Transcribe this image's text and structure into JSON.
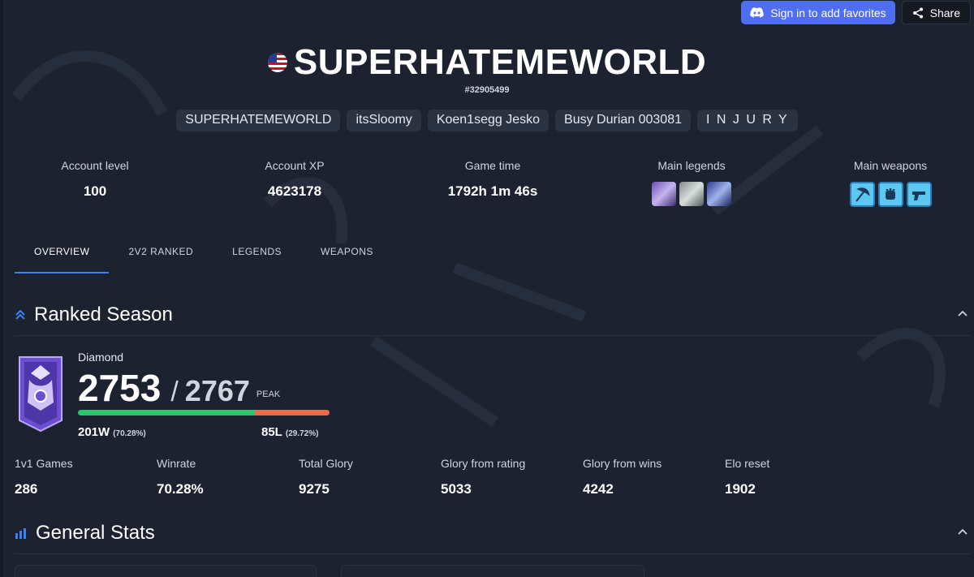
{
  "top": {
    "discord_label": "Sign in to add favorites",
    "share_label": "Share"
  },
  "player": {
    "name": "SUPERHATEMEWORLD",
    "id": "#32905499",
    "flag": "us-flag-icon"
  },
  "aliases": [
    "SUPERHATEMEWORLD",
    "itsSloomy",
    "Koen1segg Jesko",
    "Busy Durian 003081",
    "I N J U R Y"
  ],
  "stats": {
    "account_level": {
      "label": "Account level",
      "value": "100"
    },
    "account_xp": {
      "label": "Account XP",
      "value": "4623178"
    },
    "game_time": {
      "label": "Game time",
      "value": "1792h 1m 46s"
    },
    "main_legends": {
      "label": "Main legends",
      "icons": [
        "legend-icon",
        "legend-icon",
        "legend-icon"
      ]
    },
    "main_weapons": {
      "label": "Main weapons",
      "icons": [
        "scythe-icon",
        "gauntlets-icon",
        "blaster-icon"
      ]
    }
  },
  "tabs": [
    "OVERVIEW",
    "2V2 RANKED",
    "LEGENDS",
    "WEAPONS"
  ],
  "ranked": {
    "title": "Ranked Season",
    "tier": "Diamond",
    "rating": "2753",
    "slash": "/",
    "peak_rating": "2767",
    "peak_label": "PEAK",
    "win_fraction": 0.7028,
    "wins": "201W",
    "wins_pct": "(70.28%)",
    "losses": "85L",
    "losses_pct": "(29.72%)",
    "stats": [
      {
        "label": "1v1 Games",
        "value": "286"
      },
      {
        "label": "Winrate",
        "value": "70.28%"
      },
      {
        "label": "Total Glory",
        "value": "9275"
      },
      {
        "label": "Glory from rating",
        "value": "5033"
      },
      {
        "label": "Glory from wins",
        "value": "4242"
      },
      {
        "label": "Elo reset",
        "value": "1902"
      }
    ]
  },
  "general": {
    "title": "General Stats"
  },
  "colors": {
    "accent": "#3b82f6",
    "win": "#2dc46b",
    "loss": "#ec6a4c",
    "discord": "#4f6ef2",
    "background": "#1c2230"
  }
}
